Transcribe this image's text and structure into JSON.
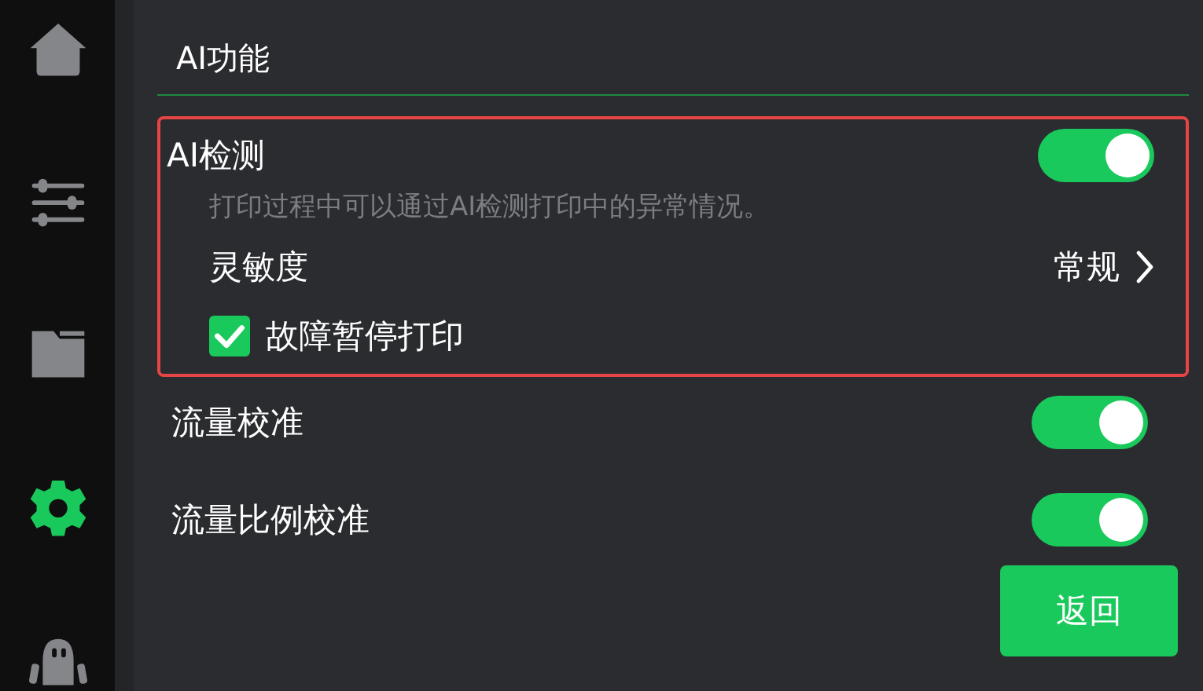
{
  "sidebar": {
    "items": [
      {
        "kind": "home",
        "selected": false
      },
      {
        "kind": "sliders",
        "selected": false
      },
      {
        "kind": "folder",
        "selected": false
      },
      {
        "kind": "gear",
        "selected": true
      },
      {
        "kind": "robot",
        "selected": false
      }
    ]
  },
  "section": {
    "title": "AI功能"
  },
  "ai_detection": {
    "label": "AI检测",
    "on": true,
    "description": "打印过程中可以通过AI检测打印中的异常情况。",
    "sensitivity": {
      "label": "灵敏度",
      "value": "常规"
    },
    "pause_on_fault": {
      "label": "故障暂停打印",
      "checked": true
    }
  },
  "settings": [
    {
      "label": "流量校准",
      "on": true
    },
    {
      "label": "流量比例校准",
      "on": true
    }
  ],
  "back_button": "返回"
}
